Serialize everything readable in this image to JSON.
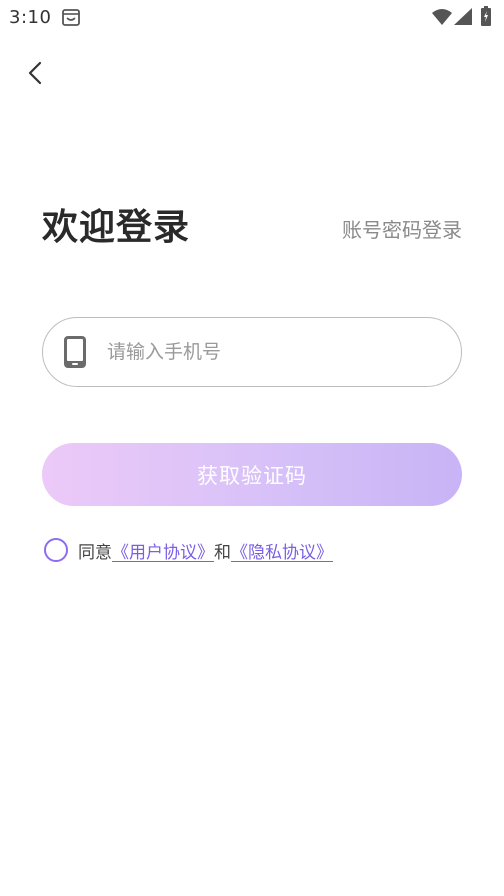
{
  "status_bar": {
    "time": "3:10"
  },
  "header": {
    "title": "欢迎登录",
    "alt_login_label": "账号密码登录"
  },
  "phone_input": {
    "placeholder": "请输入手机号",
    "value": ""
  },
  "actions": {
    "get_code_label": "获取验证码"
  },
  "agreement": {
    "prefix": "同意",
    "user_agreement": "《用户协议》",
    "conjunction": "和",
    "privacy_policy": "《隐私协议》",
    "checked": false
  },
  "colors": {
    "accent": "#7b5ee6",
    "button_gradient_start": "#ecc9f8",
    "button_gradient_end": "#c8b4f6"
  }
}
